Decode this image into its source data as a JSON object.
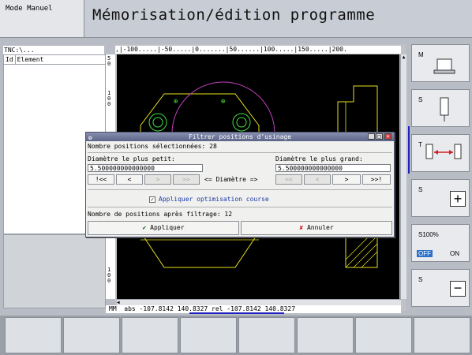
{
  "header": {
    "mode": "Mode Manuel",
    "title": "Mémorisation/édition programme"
  },
  "left_panel": {
    "path": "TNC:\\...",
    "columns": [
      "Id",
      "Element"
    ]
  },
  "graphics": {
    "ruler_top": ",|-100.....|-50.....|0.......|50......|100.....|150.....|200.",
    "ruler_left_a": "50",
    "ruler_left_b": "100",
    "ruler_left_c": "100",
    "coordinates": "MM  abs -107.8142 140.8327 rel -107.8142 140.8327",
    "colors": {
      "canvas": "#000000",
      "contour": "#e8e020",
      "circle": "#40e040",
      "arc": "#c040c0",
      "hatch": "#e8e020"
    }
  },
  "dialog": {
    "title": "Filtrer positions d'usinage",
    "selected_label": "Nombre positions sélectionnées: 28",
    "min_label": "Diamètre le plus petit:",
    "min_value": "5.500000000000000",
    "max_label": "Diamètre le plus grand:",
    "max_value": "5.500000000000000",
    "diameter_label": "<= Diamètre =>",
    "nav_left": [
      "!<<",
      "<",
      ">",
      ">>"
    ],
    "nav_right": [
      "<<",
      "<",
      ">",
      ">>!"
    ],
    "optimize_label": "Appliquer optimisation course",
    "after_label": "Nombre de positions après filtrage: 12",
    "apply_label": "Appliquer",
    "cancel_label": "Annuler"
  },
  "right_softkeys": {
    "key1": "M",
    "key2": "S",
    "key3": "T",
    "key4": "S",
    "key5_pct": "S100%",
    "key5_off": "OFF",
    "key5_on": "ON",
    "key6": "S"
  }
}
